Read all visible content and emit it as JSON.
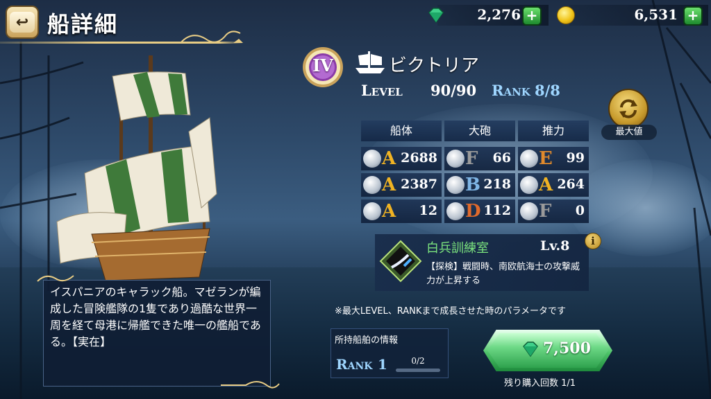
{
  "header": {
    "title": "船詳細",
    "back_label": "↩"
  },
  "currency": {
    "gems": "2,276",
    "coins": "6,531",
    "plus_label": "+"
  },
  "ship": {
    "rank_numeral": "IV",
    "name": "ビクトリア",
    "level_label": "Level",
    "level_value": "90/90",
    "rank_label": "Rank",
    "rank_value": "8/8"
  },
  "max_button": {
    "label": "最大値"
  },
  "stats": {
    "headers": [
      "船体",
      "大砲",
      "推力"
    ],
    "rows": [
      [
        {
          "icon": "supplies-icon",
          "grade": "A",
          "grade_color": "#f0b323",
          "value": "2688"
        },
        {
          "icon": "cannon-icon",
          "grade": "F",
          "grade_color": "#9a9a9a",
          "value": "66"
        },
        {
          "icon": "sail-icon",
          "grade": "E",
          "grade_color": "#e08a2c",
          "value": "99"
        }
      ],
      [
        {
          "icon": "armor-icon",
          "grade": "A",
          "grade_color": "#f0b323",
          "value": "2387"
        },
        {
          "icon": "swivel-gun-icon",
          "grade": "B",
          "grade_color": "#7fb6e6",
          "value": "218"
        },
        {
          "icon": "helm-icon",
          "grade": "A",
          "grade_color": "#f0b323",
          "value": "264"
        }
      ],
      [
        {
          "icon": "barrel-icon",
          "grade": "A",
          "grade_color": "#f0b323",
          "value": "12"
        },
        {
          "icon": "long-gun-icon",
          "grade": "D",
          "grade_color": "#e06a2c",
          "value": "112"
        },
        {
          "icon": "oar-icon",
          "grade": "F",
          "grade_color": "#9a9a9a",
          "value": "0"
        }
      ]
    ]
  },
  "facility": {
    "name": "白兵訓練室",
    "level": "Lv.8",
    "description": "【探検】戦闘時、南欧航海士の攻撃威力が上昇する",
    "info_label": "i"
  },
  "note": "※最大LEVEL、RANKまで成長させた時のパラメータです",
  "owned": {
    "title": "所持船舶の情報",
    "rank_label": "Rank",
    "rank_value": "1",
    "progress_text": "0/2",
    "progress": 0
  },
  "buy": {
    "price": "7,500",
    "remaining": "残り購入回数 1/1"
  },
  "description": "イスパニアのキャラック船。マゼランが編成した冒険艦隊の1隻であり過酷な世界一周を経て母港に帰艦できた唯一の艦船である。【実在】",
  "colors": {
    "gold": "#e8cc84",
    "rank_blue": "#9fd6ff",
    "facility_green": "#7be37e"
  }
}
